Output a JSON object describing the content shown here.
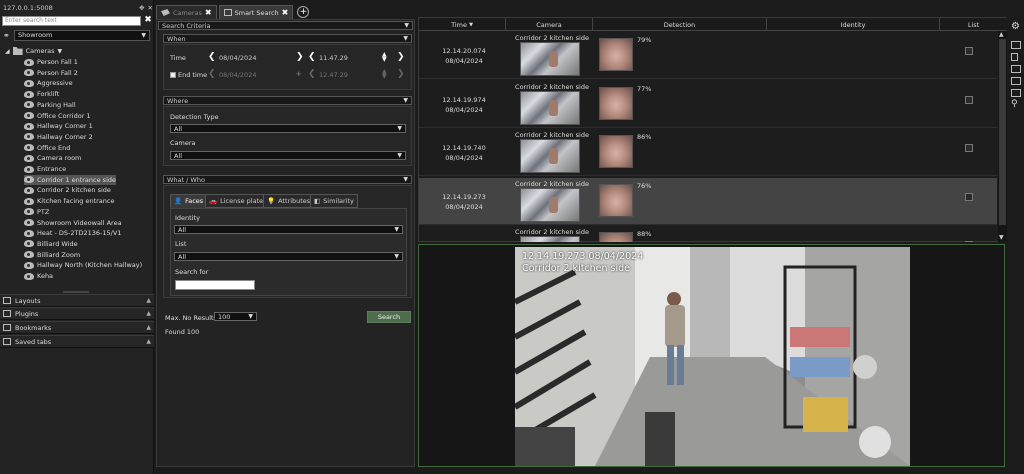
{
  "server": {
    "address": "127.0.0.1:5008"
  },
  "left_panel": {
    "search_placeholder": "Enter search text",
    "view_selector": "Showroom",
    "tree_root": "Cameras",
    "cameras": [
      "Person Fall 1",
      "Person Fall 2",
      "Aggressive",
      "Forklift",
      "Parking Hall",
      "Office Corridor 1",
      "Hallway Corner 1",
      "Hallway Corner 2",
      "Office End",
      "Camera room",
      "Entrance",
      "Corridor 1 entrance side",
      "Corridor 2 kitchen side",
      "Kitchen facing entrance",
      "PTZ",
      "Showroom Videowall Area",
      "Heat - DS-2TD2136-15/V1",
      "Billiard Wide",
      "Billiard Zoom",
      "Hallway North (Kitchen Hallway)",
      "Keha"
    ],
    "selected_camera": "Corridor 1 entrance side",
    "sections": [
      "Layouts",
      "Plugins",
      "Bookmarks",
      "Saved tabs"
    ]
  },
  "tabs": [
    {
      "label": "Cameras"
    },
    {
      "label": "Smart Search"
    }
  ],
  "criteria": {
    "header": "Search Criteria",
    "when": {
      "title": "When",
      "time_label": "Time",
      "date": "08/04/2024",
      "time": "11.47.29",
      "end_time_label": "End time",
      "end_date": "08/04/2024",
      "end_time": "12.47.29"
    },
    "where": {
      "title": "Where",
      "detection_type_label": "Detection Type",
      "detection_type_value": "All",
      "camera_label": "Camera",
      "camera_value": "All"
    },
    "what_who": {
      "title": "What / Who",
      "tabs": [
        "Faces",
        "License plates",
        "Attributes",
        "Similarity"
      ],
      "identity_label": "Identity",
      "identity_value": "All",
      "list_label": "List",
      "list_value": "All",
      "search_for_label": "Search for",
      "search_for_value": ""
    },
    "max_results_label": "Max. No Results",
    "max_results_value": "100",
    "search_button": "Search",
    "found": "Found 100"
  },
  "results": {
    "columns": [
      "Time",
      "Camera",
      "Detection",
      "Identity",
      "List"
    ],
    "rows": [
      {
        "time": "12.14.20.074",
        "date": "08/04/2024",
        "camera": "Corridor 2 kitchen side",
        "score": "79%"
      },
      {
        "time": "12.14.19.974",
        "date": "08/04/2024",
        "camera": "Corridor 2 kitchen side",
        "score": "77%"
      },
      {
        "time": "12.14.19.740",
        "date": "08/04/2024",
        "camera": "Corridor 2 kitchen side",
        "score": "86%"
      },
      {
        "time": "12.14.19.273",
        "date": "08/04/2024",
        "camera": "Corridor 2 kitchen side",
        "score": "76%"
      },
      {
        "time": "",
        "date": "",
        "camera": "Corridor 2 kitchen side",
        "score": "88%"
      }
    ],
    "selected_row": 3
  },
  "video": {
    "timestamp": "12.14.19.273  08/04/2024",
    "camera_name": "Corridor 2 kitchen side"
  },
  "colors": {
    "accent_green": "#4d6d4d",
    "selected_row": "#444444"
  }
}
